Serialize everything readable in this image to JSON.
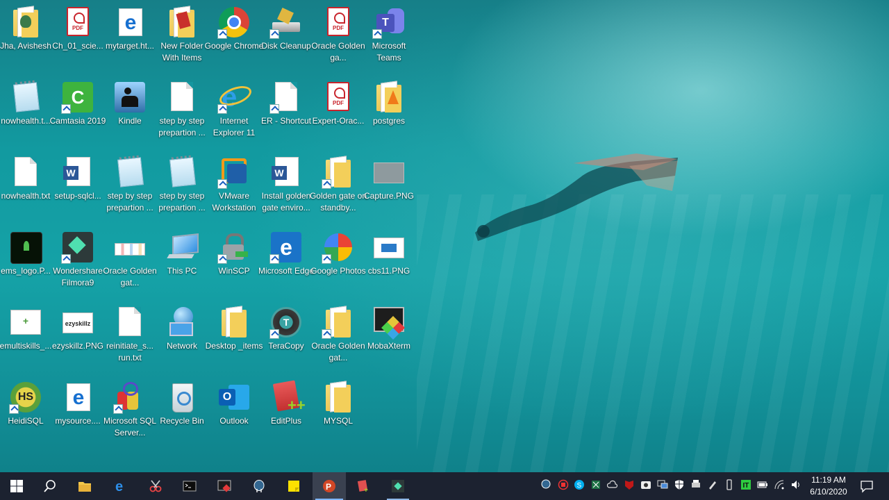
{
  "desktop_icons": [
    {
      "id": "jha",
      "label": "Jha, Avishesh",
      "icon": "user-folder-icon"
    },
    {
      "id": "ch01",
      "label": "Ch_01_scie...",
      "icon": "pdf-icon"
    },
    {
      "id": "mytarget",
      "label": "mytarget.ht...",
      "icon": "edge-html-icon"
    },
    {
      "id": "newfolder",
      "label": "New Folder With Items",
      "icon": "winrar-icon"
    },
    {
      "id": "chrome",
      "label": "Google Chrome",
      "icon": "chrome-icon"
    },
    {
      "id": "diskcleanup",
      "label": "Disk Cleanup",
      "icon": "disk-cleanup-icon"
    },
    {
      "id": "oracle1",
      "label": "Oracle Golden ga...",
      "icon": "pdf-icon"
    },
    {
      "id": "teams",
      "label": "Microsoft Teams",
      "icon": "teams-icon"
    },
    {
      "id": "nowhealth1",
      "label": "nowhealth.t...",
      "icon": "notepad-icon"
    },
    {
      "id": "camtasia",
      "label": "Camtasia 2019",
      "icon": "camtasia-icon"
    },
    {
      "id": "kindle",
      "label": "Kindle",
      "icon": "kindle-icon"
    },
    {
      "id": "step1",
      "label": "step by step prepartion ...",
      "icon": "text-file-icon"
    },
    {
      "id": "ie",
      "label": "Internet Explorer 11",
      "icon": "ie-icon"
    },
    {
      "id": "er",
      "label": "ER - Shortcut",
      "icon": "blank-file-icon"
    },
    {
      "id": "expert",
      "label": "Expert-Orac...",
      "icon": "pdf-icon"
    },
    {
      "id": "postgres",
      "label": "postgres",
      "icon": "vlc-folder-icon"
    },
    {
      "id": "nowhealth2",
      "label": "nowhealth.txt",
      "icon": "text-file-icon"
    },
    {
      "id": "setup",
      "label": "setup-sqlcl...",
      "icon": "word-icon"
    },
    {
      "id": "step2",
      "label": "step by step prepartion ...",
      "icon": "notepad-icon"
    },
    {
      "id": "step3",
      "label": "step by step prepartion ...",
      "icon": "notepad-icon"
    },
    {
      "id": "vmware",
      "label": "VMware Workstation",
      "icon": "vmware-icon"
    },
    {
      "id": "install",
      "label": "Install golden gate enviro...",
      "icon": "word-icon"
    },
    {
      "id": "goldengate",
      "label": "Golden gate on standby...",
      "icon": "folder-icon"
    },
    {
      "id": "capture",
      "label": "Capture.PNG",
      "icon": "image-icon"
    },
    {
      "id": "ems",
      "label": "ems_logo.P...",
      "icon": "image-icon"
    },
    {
      "id": "filmora",
      "label": "Wondershare Filmora9",
      "icon": "filmora-icon"
    },
    {
      "id": "oracle2",
      "label": "Oracle Golden gat...",
      "icon": "image-icon"
    },
    {
      "id": "thispc",
      "label": "This PC",
      "icon": "computer-icon"
    },
    {
      "id": "winscp",
      "label": "WinSCP",
      "icon": "winscp-icon"
    },
    {
      "id": "edge",
      "label": "Microsoft Edge",
      "icon": "edge-icon"
    },
    {
      "id": "photos",
      "label": "Google Photos",
      "icon": "google-photos-icon"
    },
    {
      "id": "cbs11",
      "label": "cbs11.PNG",
      "icon": "image-icon"
    },
    {
      "id": "emulti",
      "label": "emultiskills_...",
      "icon": "image-icon"
    },
    {
      "id": "ezyskillz",
      "label": "ezyskillz.PNG",
      "icon": "image-icon"
    },
    {
      "id": "reinitiate",
      "label": "reinitiate_s... run.txt",
      "icon": "text-file-icon"
    },
    {
      "id": "network",
      "label": "Network",
      "icon": "network-icon"
    },
    {
      "id": "desktopitems",
      "label": "Desktop _items",
      "icon": "folder-icon"
    },
    {
      "id": "teracopy",
      "label": "TeraCopy",
      "icon": "teracopy-icon"
    },
    {
      "id": "oracle3",
      "label": "Oracle Golden gat...",
      "icon": "folder-icon"
    },
    {
      "id": "mobaxterm",
      "label": "MobaXterm",
      "icon": "mobaxterm-icon"
    },
    {
      "id": "heidisql",
      "label": "HeidiSQL",
      "icon": "heidisql-icon"
    },
    {
      "id": "mysource",
      "label": "mysource....",
      "icon": "edge-html-icon"
    },
    {
      "id": "mssql",
      "label": "Microsoft SQL Server...",
      "icon": "sql-server-icon"
    },
    {
      "id": "recycle",
      "label": "Recycle Bin",
      "icon": "recycle-bin-icon"
    },
    {
      "id": "outlook",
      "label": "Outlook",
      "icon": "outlook-icon"
    },
    {
      "id": "editplus",
      "label": "EditPlus",
      "icon": "editplus-icon"
    },
    {
      "id": "mysql",
      "label": "MYSQL",
      "icon": "folder-icon"
    }
  ],
  "icon_glyph_text": {
    "pdf": "PDF",
    "edge": "e",
    "teams": "T",
    "word": "W",
    "outlook": "O",
    "heidisql": "HS",
    "teracopy": "T",
    "camtasia": "C",
    "ppt": "P",
    "ezyskillz": "ezyskillz"
  },
  "taskbar": {
    "items": [
      {
        "id": "start",
        "icon": "windows-start-icon"
      },
      {
        "id": "search",
        "icon": "search-icon"
      },
      {
        "id": "explorer",
        "icon": "file-explorer-icon"
      },
      {
        "id": "edge",
        "icon": "edge-icon"
      },
      {
        "id": "snip",
        "icon": "snipping-tool-icon"
      },
      {
        "id": "cmd",
        "icon": "command-prompt-icon"
      },
      {
        "id": "moba",
        "icon": "mobaxterm-icon"
      },
      {
        "id": "pgadmin",
        "icon": "postgresql-icon"
      },
      {
        "id": "sticky",
        "icon": "sticky-notes-icon"
      },
      {
        "id": "ppt",
        "icon": "powerpoint-icon",
        "active": true
      },
      {
        "id": "editplus",
        "icon": "editplus-icon"
      },
      {
        "id": "filmora",
        "icon": "filmora-icon"
      }
    ],
    "tray_icons": [
      "postgres-tray-icon",
      "record-icon",
      "skype-icon",
      "excel-tray-icon",
      "cloud-icon",
      "mcafee-icon",
      "camera-icon",
      "display-icon",
      "shield-icon",
      "printer-icon",
      "usb-icon",
      "pen-icon",
      "battery-usb-icon",
      "green-app-icon",
      "battery-icon",
      "wifi-icon",
      "volume-icon"
    ],
    "time": "11:19 AM",
    "date": "6/10/2020"
  },
  "colors": {
    "taskbar": "#1c2230",
    "water": "#15a2a7",
    "active_underline": "#7fb6ff"
  }
}
